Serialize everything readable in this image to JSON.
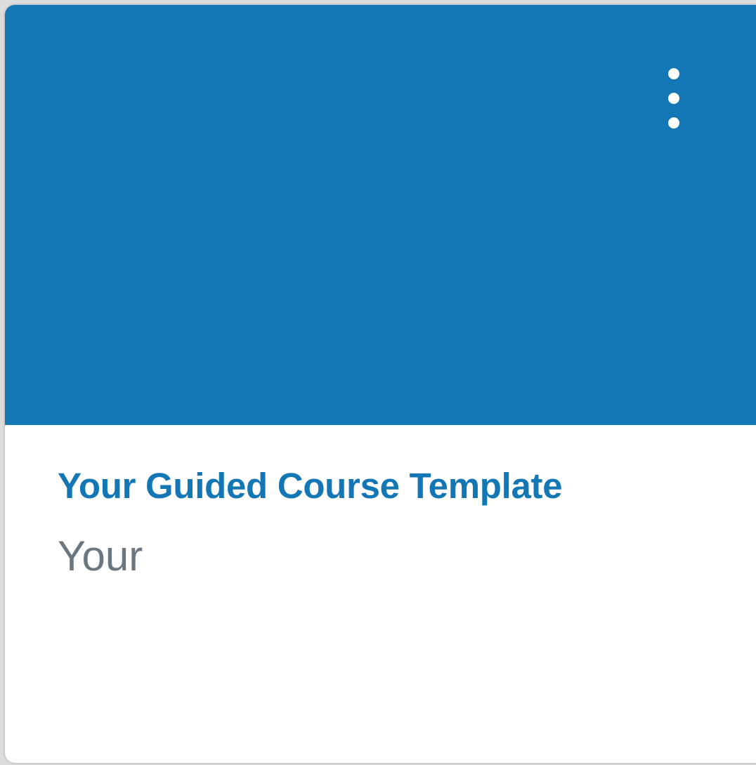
{
  "theme": {
    "hero_color": "#1377b5",
    "title_color": "#1377b5",
    "subtitle_color": "#6b7780"
  },
  "card": {
    "title": "Your Guided Course Template",
    "subtitle": "Your",
    "menu_icon": "vertical-ellipsis-icon"
  }
}
